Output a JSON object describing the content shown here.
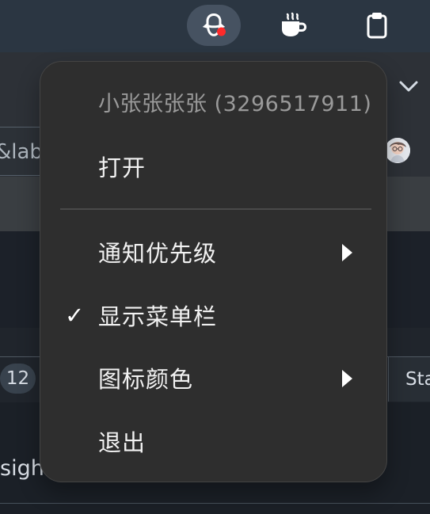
{
  "top_bar": {
    "tray_icons": [
      {
        "name": "qq-tray-icon",
        "active": true,
        "has_notification": true
      },
      {
        "name": "coffee-icon",
        "active": false
      },
      {
        "name": "clipboard-icon",
        "active": false
      }
    ],
    "colors": {
      "bar": "#2b3642",
      "active_icon_bg": "#465261",
      "notification": "#ff2a2a"
    }
  },
  "background": {
    "partial_field_text": "&lab",
    "count_badge": "12",
    "status_tab": "Sta",
    "insights_text": "sights"
  },
  "menu": {
    "header": "小张张张张 (3296517911)",
    "open": "打开",
    "notification_priority": "通知优先级",
    "show_menubar": "显示菜单栏",
    "show_menubar_checked": true,
    "check_symbol": "✓",
    "icon_color": "图标颜色",
    "quit": "退出"
  }
}
